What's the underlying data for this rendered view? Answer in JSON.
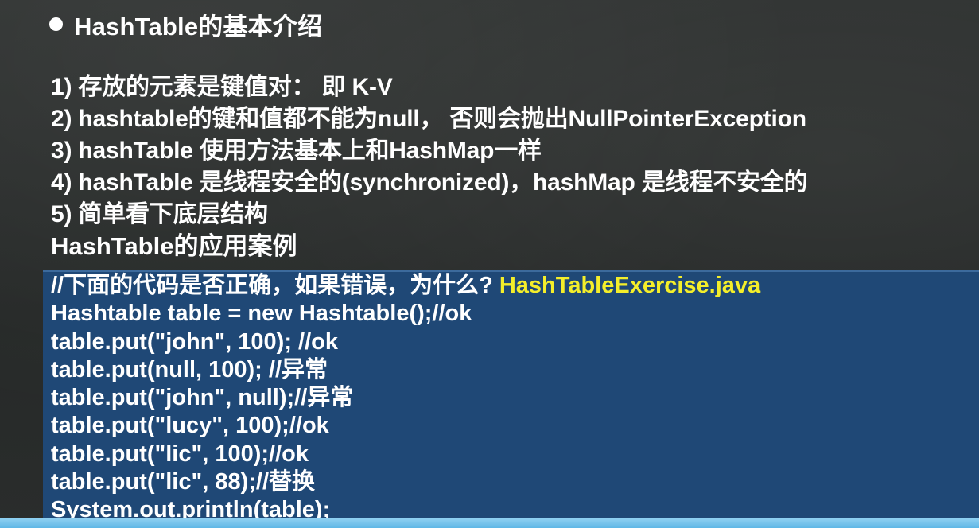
{
  "slide": {
    "title": "HashTable的基本介绍",
    "points": [
      "1) 存放的元素是键值对： 即 K-V",
      "2) hashtable的键和值都不能为null， 否则会抛出NullPointerException",
      "3) hashTable 使用方法基本上和HashMap一样",
      "4) hashTable 是线程安全的(synchronized)，hashMap 是线程不安全的",
      "5) 简单看下底层结构"
    ],
    "section_heading": "HashTable的应用案例"
  },
  "code": {
    "comment": "//下面的代码是否正确，如果错误，为什么?",
    "filename": "HashTableExercise.java",
    "lines": [
      "Hashtable table = new Hashtable();//ok",
      "table.put(\"john\", 100); //ok",
      "table.put(null, 100); //异常",
      "table.put(\"john\", null);//异常",
      "table.put(\"lucy\", 100);//ok",
      "table.put(\"lic\", 100);//ok",
      "table.put(\"lic\", 88);//替换",
      "System.out.println(table);"
    ]
  },
  "colors": {
    "background": "#2c2f2e",
    "code_panel": "#1f4876",
    "filename_highlight": "#f4ee2a",
    "bottom_bar": "#6cc0ea"
  },
  "icons": {
    "bullet": "filled-circle"
  }
}
